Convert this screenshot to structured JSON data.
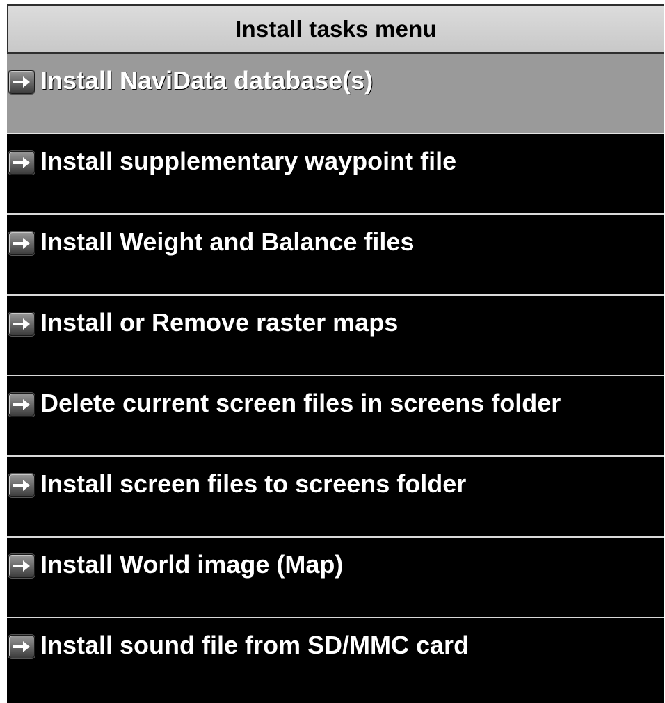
{
  "header": {
    "title": "Install tasks menu"
  },
  "menu": {
    "selected_index": 0,
    "items": [
      {
        "label": "Install NaviData database(s)",
        "icon": "arrow-right-icon"
      },
      {
        "label": "Install supplementary waypoint file",
        "icon": "arrow-right-icon"
      },
      {
        "label": "Install Weight and Balance files",
        "icon": "arrow-right-icon"
      },
      {
        "label": "Install or Remove raster maps",
        "icon": "arrow-right-icon"
      },
      {
        "label": "Delete current screen files in screens folder",
        "icon": "arrow-right-icon"
      },
      {
        "label": "Install screen files to screens folder",
        "icon": "arrow-right-icon"
      },
      {
        "label": "Install World image (Map)",
        "icon": "arrow-right-icon"
      },
      {
        "label": "Install sound file from SD/MMC card",
        "icon": "arrow-right-icon"
      }
    ]
  },
  "colors": {
    "background": "#000000",
    "header_bg": "#d0d0d0",
    "selected_bg": "#9a9a9a",
    "text": "#ffffff",
    "divider": "#d8d8d8"
  }
}
